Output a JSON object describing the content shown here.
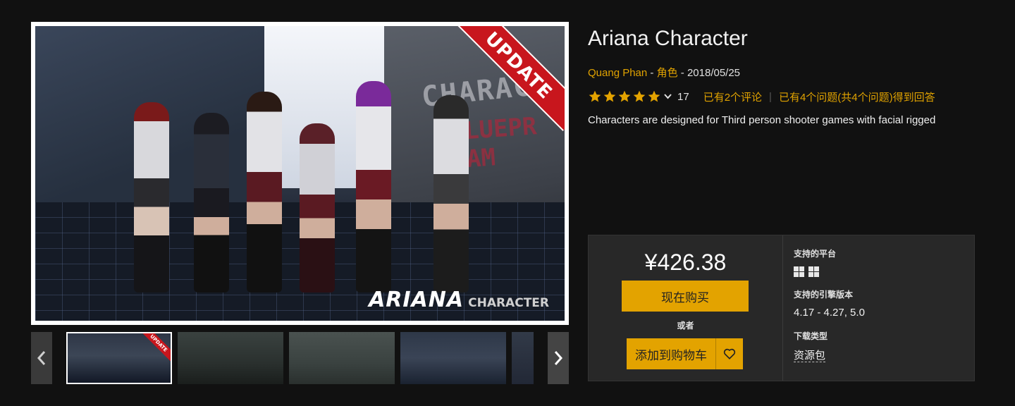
{
  "product": {
    "title": "Ariana Character",
    "author": "Quang Phan",
    "meta_sep1": " - ",
    "category": "角色",
    "meta_sep2": " - ",
    "date": "2018/05/25",
    "rating": {
      "stars": 5,
      "count": "17"
    },
    "reviews_link": "已有2个评论",
    "qa_link": "已有4个问题(共4个问题)得到回答",
    "description": "Characters are designed for Third person shooter games with facial rigged"
  },
  "main_image": {
    "ribbon_text": "UPDATE",
    "graffiti_top": "CHARAC",
    "graffiti_bottom": "BLUEPR SAM",
    "logo_big": "ARIANA",
    "logo_small": "CHARACTER"
  },
  "thumbnails": {
    "count": 5,
    "active_index": 0,
    "ribbon_text": "UPDATE"
  },
  "purchase": {
    "price": "¥426.38",
    "buy_now_label": "现在购买",
    "or_label": "或者",
    "add_to_cart_label": "添加到购物车"
  },
  "specs": {
    "platform_label": "支持的平台",
    "platforms": [
      "windows-icon",
      "windows-icon"
    ],
    "engine_label": "支持的引擎版本",
    "engine_versions": "4.17 - 4.27, 5.0",
    "download_label": "下载类型",
    "download_type": "资源包"
  },
  "colors": {
    "accent": "#e3a300",
    "link": "#e0a200",
    "background": "#111111",
    "panel": "#282828",
    "ribbon": "#c8161d"
  }
}
